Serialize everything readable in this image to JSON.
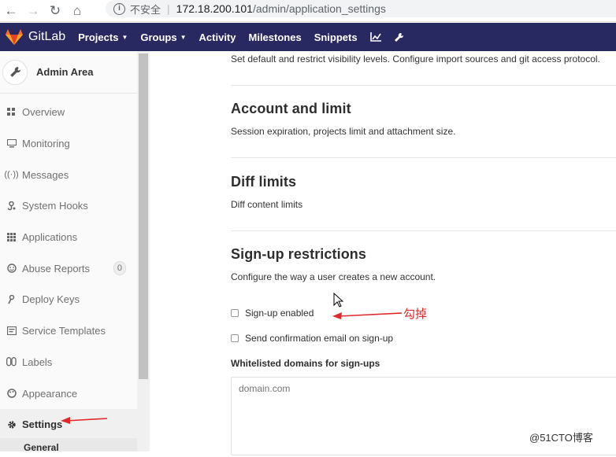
{
  "browser": {
    "insecure_label": "不安全",
    "url_host": "172.18.200.101",
    "url_path": "/admin/application_settings"
  },
  "topnav": {
    "brand": "GitLab",
    "items": [
      "Projects",
      "Groups",
      "Activity",
      "Milestones",
      "Snippets"
    ],
    "brand_color": "#292961"
  },
  "sidebar": {
    "title": "Admin Area",
    "items": [
      {
        "label": "Overview",
        "icon": "grid-icon"
      },
      {
        "label": "Monitoring",
        "icon": "monitor-icon"
      },
      {
        "label": "Messages",
        "icon": "broadcast-icon"
      },
      {
        "label": "System Hooks",
        "icon": "hook-icon"
      },
      {
        "label": "Applications",
        "icon": "apps-icon"
      },
      {
        "label": "Abuse Reports",
        "icon": "smiley-icon",
        "badge": "0"
      },
      {
        "label": "Deploy Keys",
        "icon": "key-icon"
      },
      {
        "label": "Service Templates",
        "icon": "template-icon"
      },
      {
        "label": "Labels",
        "icon": "labels-icon"
      },
      {
        "label": "Appearance",
        "icon": "palette-icon"
      },
      {
        "label": "Settings",
        "icon": "gear-icon"
      }
    ],
    "sub_item": "General"
  },
  "main": {
    "visibility_desc": "Set default and restrict visibility levels. Configure import sources and git access protocol.",
    "account_title": "Account and limit",
    "account_desc": "Session expiration, projects limit and attachment size.",
    "diff_title": "Diff limits",
    "diff_desc": "Diff content limits",
    "signup_title": "Sign-up restrictions",
    "signup_desc": "Configure the way a user creates a new account.",
    "signup_enabled_label": "Sign-up enabled",
    "send_confirmation_label": "Send confirmation email on sign-up",
    "whitelist_label": "Whitelisted domains for sign-ups",
    "whitelist_placeholder": "domain.com"
  },
  "annotation": {
    "text": "勾掉",
    "color": "#e0292b"
  },
  "watermark": "@51CTO博客"
}
